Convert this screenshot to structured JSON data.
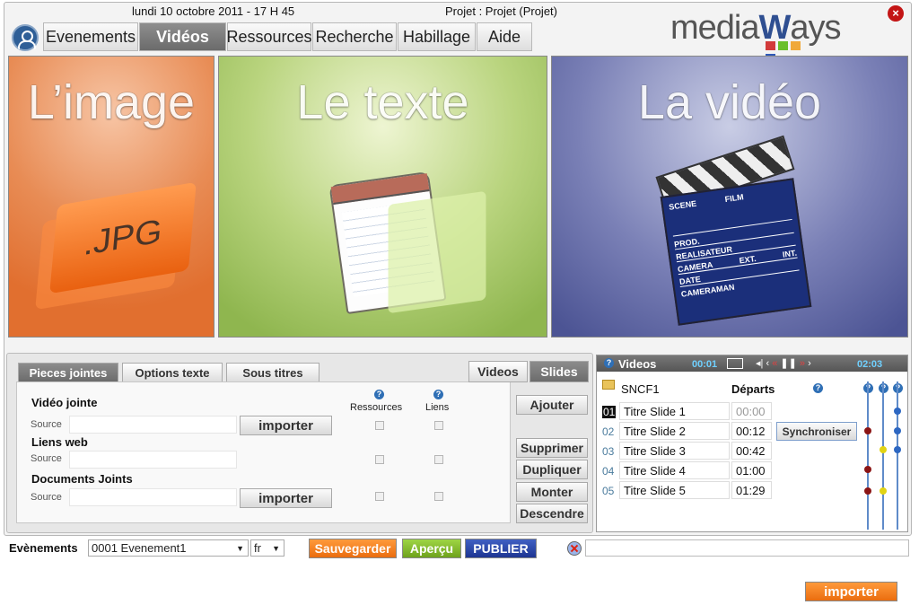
{
  "header": {
    "date": "lundi 10 octobre 2011 - 17 H 45",
    "project": "Projet : Projet (Projet)",
    "close": "×"
  },
  "logo": {
    "text_a": "media",
    "text_b": "W",
    "text_c": "ays",
    "bars": [
      "#d23b3b",
      "#6bbf2b",
      "#f0a93a",
      "#2f58b8"
    ]
  },
  "tabs": [
    "Evenements",
    "Vidéos",
    "Ressources",
    "Recherche",
    "Habillage",
    "Aide"
  ],
  "panels": [
    {
      "title": "L’image",
      "badge": ".JPG"
    },
    {
      "title": "Le texte"
    },
    {
      "title": "La vidéo",
      "clap": [
        "SCENE",
        "FILM",
        "PROD.",
        "REALISATEUR",
        "CAMERA",
        "EXT.",
        "INT.",
        "DATE",
        "CAMERAMAN"
      ]
    }
  ],
  "subtabs": [
    "Pieces jointes",
    "Options texte",
    "Sous titres"
  ],
  "mediatabs": [
    "Videos",
    "Slides"
  ],
  "form": {
    "video_jointe": "Vidéo jointe",
    "liens_web": "Liens web",
    "docs": "Documents Joints",
    "source": "Source",
    "importer": "importer",
    "ressources": "Ressources",
    "liens": "Liens",
    "help": "?"
  },
  "actions": [
    "Ajouter",
    "Supprimer",
    "Dupliquer",
    "Monter",
    "Descendre"
  ],
  "videos": {
    "title": "Videos",
    "time_left": "00:01",
    "time_right": "02:03",
    "folder": "SNCF1",
    "departs": "Départs",
    "synchro": "Synchroniser",
    "rows": [
      {
        "n": "01",
        "title": "Titre Slide 1",
        "time": "00:00"
      },
      {
        "n": "02",
        "title": "Titre Slide 2",
        "time": "00:12"
      },
      {
        "n": "03",
        "title": "Titre Slide 3",
        "time": "00:42"
      },
      {
        "n": "04",
        "title": "Titre Slide 4",
        "time": "01:00"
      },
      {
        "n": "05",
        "title": "Titre Slide 5",
        "time": "01:29"
      }
    ]
  },
  "footer": {
    "label": "Evènements",
    "event": "0001 Evenement1",
    "lang": "fr",
    "save": "Sauvegarder",
    "preview": "Aperçu",
    "publish": "PUBLIER",
    "import": "importer"
  }
}
